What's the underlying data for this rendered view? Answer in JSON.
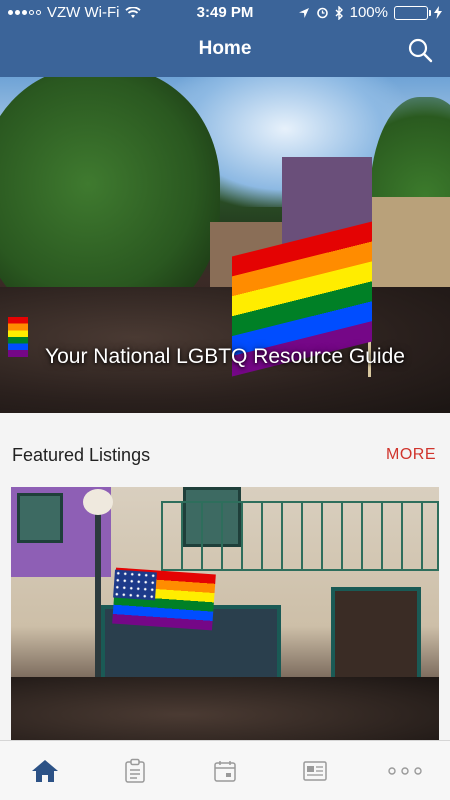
{
  "status_bar": {
    "carrier": "VZW Wi-Fi",
    "time": "3:49 PM",
    "battery": "100%"
  },
  "header": {
    "title": "Home",
    "search_icon": "search-icon"
  },
  "hero": {
    "title": "Your National LGBTQ Resource Guide"
  },
  "featured": {
    "title": "Featured Listings",
    "more_label": "MORE"
  },
  "tabs": [
    {
      "icon": "home-icon",
      "active": true
    },
    {
      "icon": "clipboard-icon",
      "active": false
    },
    {
      "icon": "calendar-icon",
      "active": false
    },
    {
      "icon": "newspaper-icon",
      "active": false
    },
    {
      "icon": "more-icon",
      "active": false
    }
  ],
  "colors": {
    "header_bg": "#3b6499",
    "accent_red": "#d0342c",
    "tab_active": "#2c5286",
    "tab_inactive": "#9a9a9a"
  }
}
